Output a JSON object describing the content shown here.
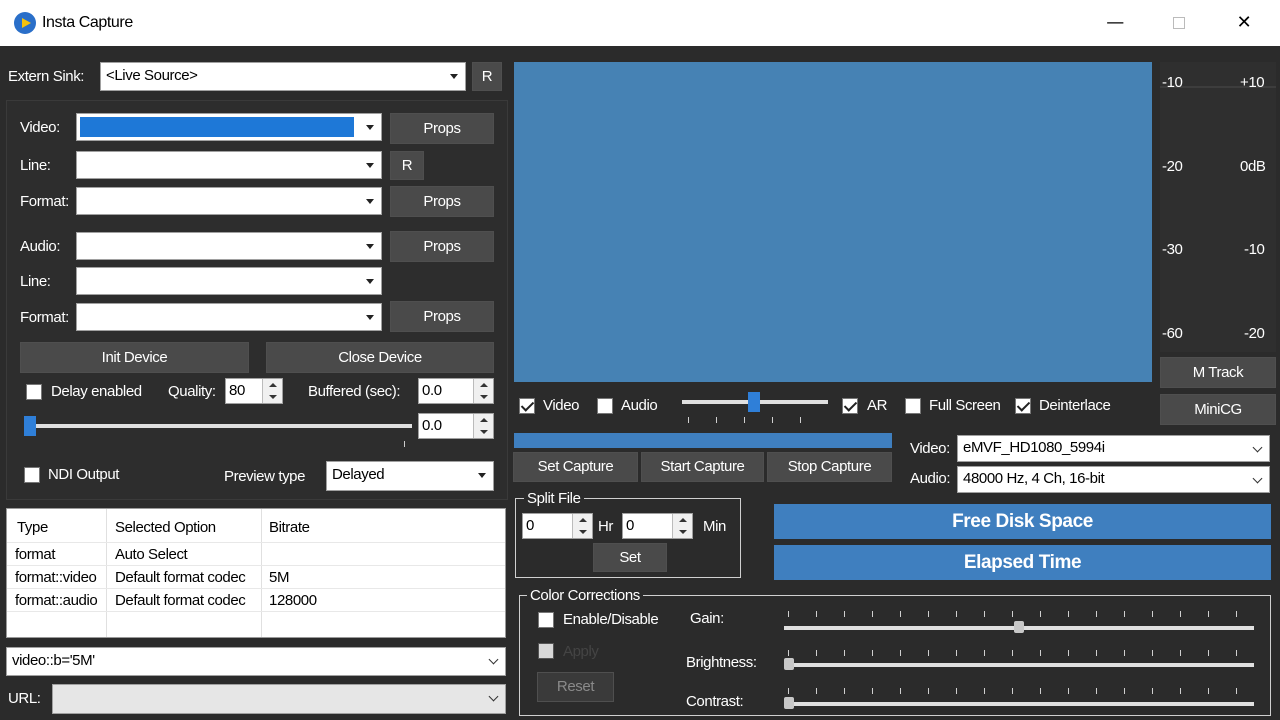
{
  "window": {
    "title": "Insta Capture"
  },
  "extern_sink": {
    "label": "Extern Sink:",
    "value": "<Live Source>",
    "refresh_label": "R"
  },
  "device": {
    "video_label": "Video:",
    "video_line_label": "Line:",
    "video_format_label": "Format:",
    "audio_label": "Audio:",
    "audio_line_label": "Line:",
    "audio_format_label": "Format:",
    "props_label": "Props",
    "line_refresh_label": "R",
    "init_label": "Init Device",
    "close_label": "Close Device"
  },
  "options": {
    "delay_label": "Delay enabled",
    "quality_label": "Quality:",
    "quality_value": "80",
    "buffered_label": "Buffered (sec):",
    "buffered_value": "0.0",
    "slider_value": "0.0",
    "ndi_label": "NDI Output",
    "preview_type_label": "Preview type",
    "preview_type_value": "Delayed"
  },
  "option_table": {
    "headers": [
      "Type",
      "Selected Option",
      "Bitrate"
    ],
    "rows": [
      [
        "format",
        "Auto Select",
        ""
      ],
      [
        "format::video",
        "Default format codec",
        "5M"
      ],
      [
        "format::audio",
        "Default format codec",
        "128000"
      ]
    ]
  },
  "bitrate_field": {
    "value": "video::b='5M'"
  },
  "url_field": {
    "label": "URL:",
    "value": ""
  },
  "preview": {
    "video_label": "Video",
    "audio_label": "Audio",
    "ar_label": "AR",
    "fullscreen_label": "Full Screen",
    "deinterlace_label": "Deinterlace",
    "video_checked": true,
    "audio_checked": false,
    "ar_checked": true,
    "fullscreen_checked": false,
    "deinterlace_checked": true
  },
  "meters": {
    "left": [
      "-10",
      "-20",
      "-30",
      "-60"
    ],
    "right": [
      "+10",
      "0dB",
      "-10",
      "-20"
    ],
    "mtrack_label": "M Track",
    "minicg_label": "MiniCG"
  },
  "capture": {
    "set_label": "Set Capture",
    "start_label": "Start Capture",
    "stop_label": "Stop Capture",
    "progress": 1.0
  },
  "format_select": {
    "video_label": "Video:",
    "video_value": "eMVF_HD1080_5994i",
    "audio_label": "Audio:",
    "audio_value": "48000 Hz, 4 Ch, 16-bit"
  },
  "split_file": {
    "title": "Split File",
    "hr_value": "0",
    "hr_label": "Hr",
    "min_value": "0",
    "min_label": "Min",
    "set_label": "Set"
  },
  "status": {
    "free_disk_label": "Free Disk Space",
    "elapsed_label": "Elapsed Time"
  },
  "color_corrections": {
    "title": "Color Corrections",
    "enable_label": "Enable/Disable",
    "apply_label": "Apply",
    "reset_label": "Reset",
    "gain_label": "Gain:",
    "brightness_label": "Brightness:",
    "contrast_label": "Contrast:"
  },
  "colors": {
    "accent": "#3f7fbf",
    "preview_bg": "#4682b4",
    "background": "#2b2b2b",
    "selection": "#1e78d7"
  },
  "icons": {
    "app": "play-icon",
    "minimize": "minimize-icon",
    "maximize": "maximize-icon",
    "close": "close-icon"
  }
}
